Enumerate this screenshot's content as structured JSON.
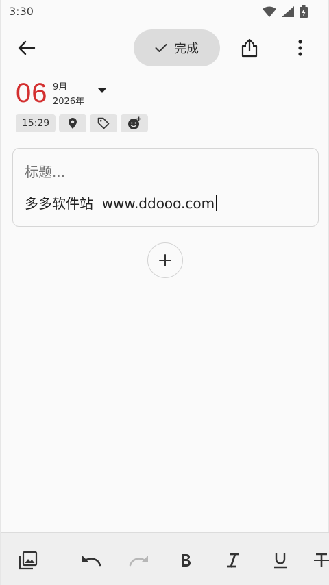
{
  "status_bar": {
    "time": "3:30"
  },
  "app_bar": {
    "done_label": "完成"
  },
  "date": {
    "day": "06",
    "month": "9月",
    "year": "2026年"
  },
  "chips": {
    "time": "15:29"
  },
  "note": {
    "title_placeholder": "标题...",
    "body_text": "多多软件站  www.ddooo.com"
  },
  "colors": {
    "accent_red": "#d32f2f",
    "done_bg": "#dcdcdc",
    "toolbar_bg": "#efefef"
  }
}
